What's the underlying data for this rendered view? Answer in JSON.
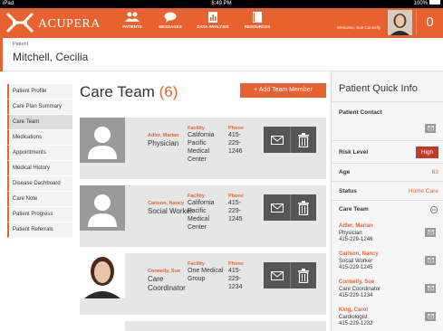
{
  "statusbar": {
    "device": "iPad",
    "time": "8:49 PM",
    "battery": "100%"
  },
  "app": {
    "brand": "ACUPERA",
    "welcome": "Welcome, Sue Connelly",
    "notification_count": "0"
  },
  "nav": [
    {
      "label": "PATIENTS",
      "icon": "people-icon"
    },
    {
      "label": "MESSAGES",
      "icon": "chat-icon"
    },
    {
      "label": "DATA ANALYSIS",
      "icon": "chart-icon"
    },
    {
      "label": "RESOURCES",
      "icon": "book-icon"
    }
  ],
  "patient": {
    "label": "Patient",
    "name": "Mitchell, Cecilia"
  },
  "sidebar": {
    "items": [
      {
        "label": "Patient Profile"
      },
      {
        "label": "Care Plan Summary"
      },
      {
        "label": "Care Team"
      },
      {
        "label": "Medications"
      },
      {
        "label": "Appointments"
      },
      {
        "label": "Medical History"
      },
      {
        "label": "Disease Dashboard"
      },
      {
        "label": "Care Note"
      },
      {
        "label": "Patient Progress"
      },
      {
        "label": "Patient Referrals"
      }
    ]
  },
  "main": {
    "title": "Care Team",
    "count": "(6)",
    "add_button": "+ Add Team Member",
    "facility_label": "Facility",
    "phone_label": "Phone",
    "members": [
      {
        "name": "Adler, Marian",
        "role": "Physician",
        "facility": "California Pacific Medical Center",
        "phone": "415-229-1246"
      },
      {
        "name": "Carlson, Nancy",
        "role": "Social Worker",
        "facility": "California Pacific Medical Center",
        "phone": "415-229-1245"
      },
      {
        "name": "Connelly, Sue",
        "role": "Care Coordinator",
        "facility": "One Medical Group",
        "phone": "415-229-1234"
      }
    ]
  },
  "quick_info": {
    "title": "Patient Quick Info",
    "contact_label": "Patient Contact",
    "risk_label": "Risk Level",
    "risk_value": "High",
    "age_label": "Age",
    "age_value": "63",
    "status_label": "Status",
    "status_value": "Home Care",
    "care_team_label": "Care Team",
    "care_team": [
      {
        "name": "Adler, Marian",
        "role": "Physician",
        "phone": "415-229-1246"
      },
      {
        "name": "Carlson, Nancy",
        "role": "Social Worker",
        "phone": "415-229-1245"
      },
      {
        "name": "Connelly, Sue",
        "role": "Care Coordinator",
        "phone": "415-229-1234"
      },
      {
        "name": "King, Carol",
        "role": "Cardiologist",
        "phone": "415-229-1232"
      }
    ]
  },
  "colors": {
    "accent": "#e8622f",
    "risk_high": "#c0392b"
  }
}
